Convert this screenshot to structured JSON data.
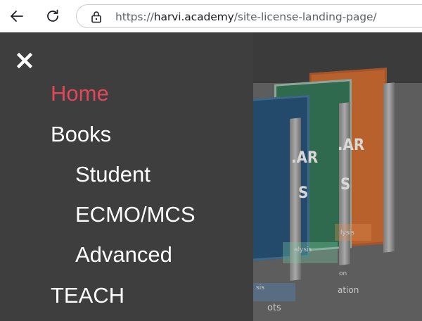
{
  "browser": {
    "url_scheme": "https://",
    "url_host": "harvi.academy",
    "url_path": "/site-license-landing-page/"
  },
  "icons": {
    "back": "back-arrow-icon",
    "reload": "reload-icon",
    "site_info": "lock-icon",
    "close": "close-icon"
  },
  "colors": {
    "menu_background": "#3f3e3e",
    "active_item": "#e0475a",
    "menu_text": "#ffffff"
  },
  "hero_books": {
    "cover_fragments": [
      ".AR",
      "S",
      ".AR",
      "S"
    ],
    "small_fragments": [
      "lysis",
      "alysis",
      "ation",
      "ots",
      "sis",
      "on"
    ]
  },
  "side_menu": {
    "items": [
      {
        "label": "Home",
        "active": true
      },
      {
        "label": "Books",
        "active": false
      },
      {
        "label": "Student",
        "active": false
      },
      {
        "label": "ECMO/MCS",
        "active": false
      },
      {
        "label": "Advanced",
        "active": false
      },
      {
        "label": "TEACH",
        "active": false
      }
    ]
  }
}
